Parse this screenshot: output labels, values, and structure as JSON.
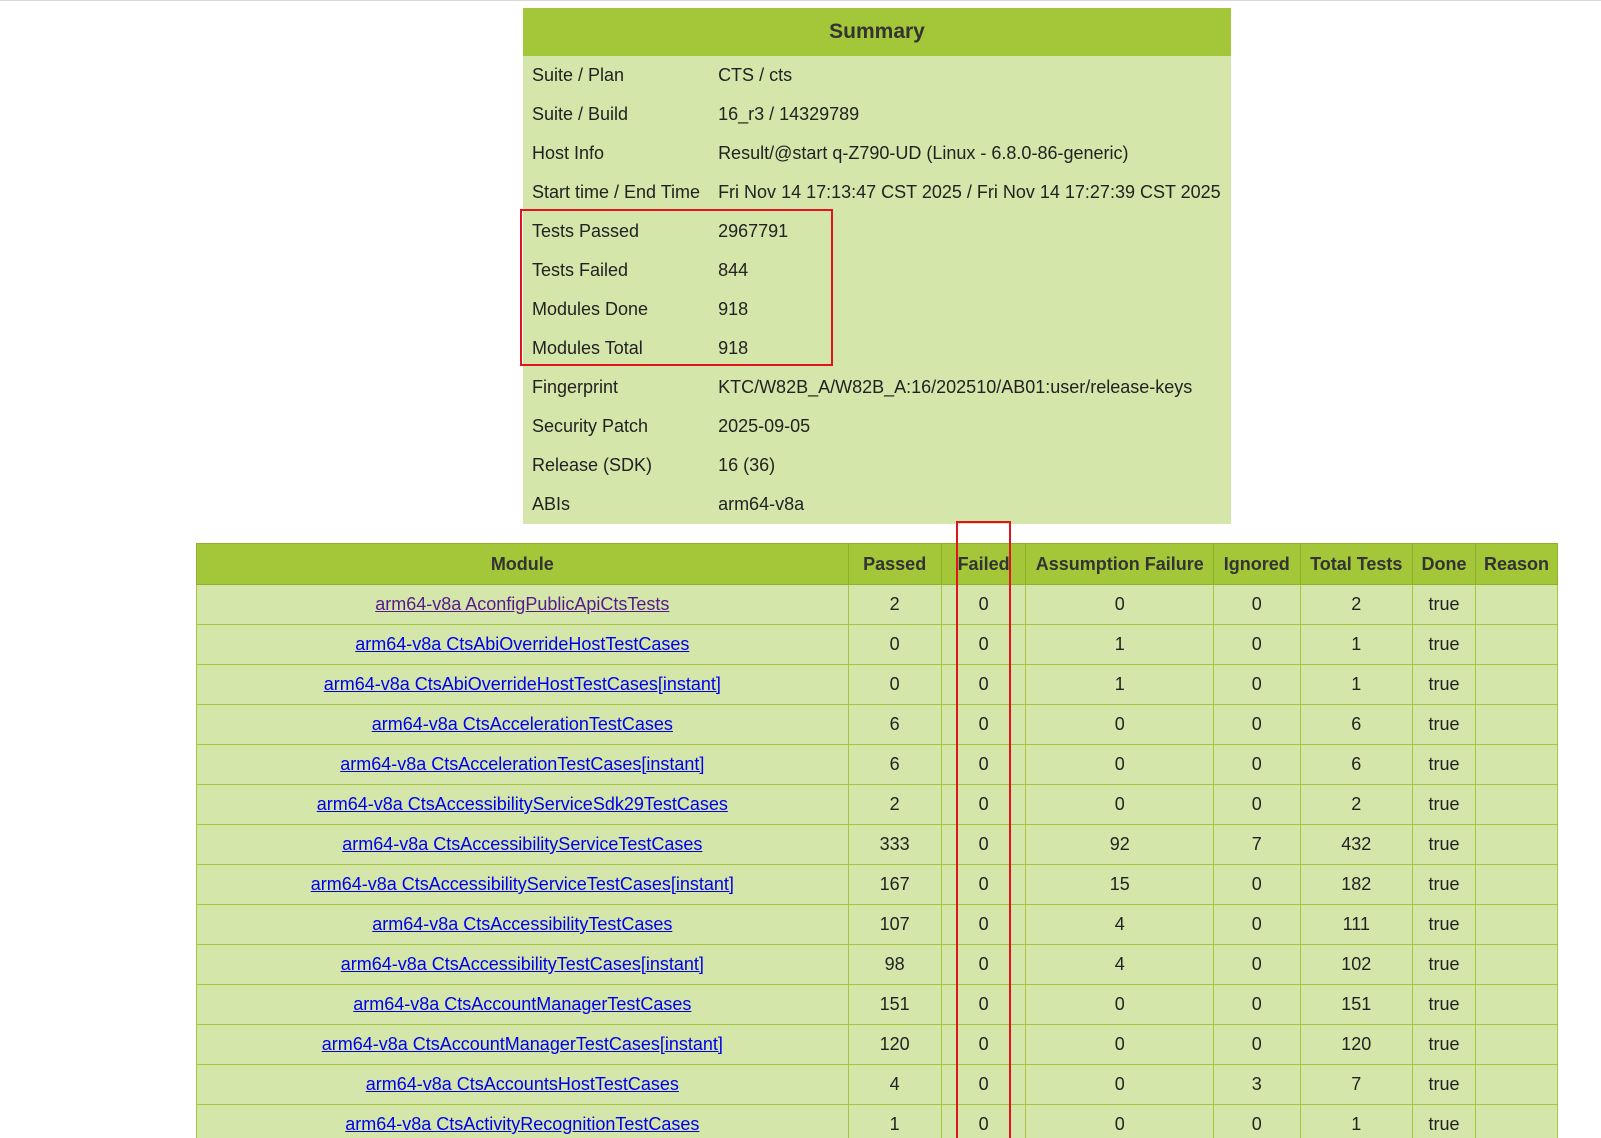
{
  "summary": {
    "title": "Summary",
    "rows": [
      {
        "label": "Suite / Plan",
        "value": "CTS / cts"
      },
      {
        "label": "Suite / Build",
        "value": "16_r3 / 14329789"
      },
      {
        "label": "Host Info",
        "value": "Result/@start q-Z790-UD (Linux - 6.8.0-86-generic)"
      },
      {
        "label": "Start time / End Time",
        "value": "Fri Nov 14 17:13:47 CST 2025 / Fri Nov 14 17:27:39 CST 2025"
      },
      {
        "label": "Tests Passed",
        "value": "2967791"
      },
      {
        "label": "Tests Failed",
        "value": "844"
      },
      {
        "label": "Modules Done",
        "value": "918"
      },
      {
        "label": "Modules Total",
        "value": "918"
      },
      {
        "label": "Fingerprint",
        "value": "KTC/W82B_A/W82B_A:16/202510/AB01:user/release-keys"
      },
      {
        "label": "Security Patch",
        "value": "2025-09-05"
      },
      {
        "label": "Release (SDK)",
        "value": "16 (36)"
      },
      {
        "label": "ABIs",
        "value": "arm64-v8a"
      }
    ]
  },
  "modules": {
    "headers": {
      "module": "Module",
      "passed": "Passed",
      "failed": "Failed",
      "assumption_failure": "Assumption Failure",
      "ignored": "Ignored",
      "total_tests": "Total Tests",
      "done": "Done",
      "reason": "Reason"
    },
    "rows": [
      {
        "module": "arm64-v8a AconfigPublicApiCtsTests",
        "visited": true,
        "passed": "2",
        "failed": "0",
        "assumption_failure": "0",
        "ignored": "0",
        "total_tests": "2",
        "done": "true",
        "reason": ""
      },
      {
        "module": "arm64-v8a CtsAbiOverrideHostTestCases",
        "visited": false,
        "passed": "0",
        "failed": "0",
        "assumption_failure": "1",
        "ignored": "0",
        "total_tests": "1",
        "done": "true",
        "reason": ""
      },
      {
        "module": "arm64-v8a CtsAbiOverrideHostTestCases[instant]",
        "visited": false,
        "passed": "0",
        "failed": "0",
        "assumption_failure": "1",
        "ignored": "0",
        "total_tests": "1",
        "done": "true",
        "reason": ""
      },
      {
        "module": "arm64-v8a CtsAccelerationTestCases",
        "visited": false,
        "passed": "6",
        "failed": "0",
        "assumption_failure": "0",
        "ignored": "0",
        "total_tests": "6",
        "done": "true",
        "reason": ""
      },
      {
        "module": "arm64-v8a CtsAccelerationTestCases[instant]",
        "visited": false,
        "passed": "6",
        "failed": "0",
        "assumption_failure": "0",
        "ignored": "0",
        "total_tests": "6",
        "done": "true",
        "reason": ""
      },
      {
        "module": "arm64-v8a CtsAccessibilityServiceSdk29TestCases",
        "visited": false,
        "passed": "2",
        "failed": "0",
        "assumption_failure": "0",
        "ignored": "0",
        "total_tests": "2",
        "done": "true",
        "reason": ""
      },
      {
        "module": "arm64-v8a CtsAccessibilityServiceTestCases",
        "visited": false,
        "passed": "333",
        "failed": "0",
        "assumption_failure": "92",
        "ignored": "7",
        "total_tests": "432",
        "done": "true",
        "reason": ""
      },
      {
        "module": "arm64-v8a CtsAccessibilityServiceTestCases[instant]",
        "visited": false,
        "passed": "167",
        "failed": "0",
        "assumption_failure": "15",
        "ignored": "0",
        "total_tests": "182",
        "done": "true",
        "reason": ""
      },
      {
        "module": "arm64-v8a CtsAccessibilityTestCases",
        "visited": false,
        "passed": "107",
        "failed": "0",
        "assumption_failure": "4",
        "ignored": "0",
        "total_tests": "111",
        "done": "true",
        "reason": ""
      },
      {
        "module": "arm64-v8a CtsAccessibilityTestCases[instant]",
        "visited": false,
        "passed": "98",
        "failed": "0",
        "assumption_failure": "4",
        "ignored": "0",
        "total_tests": "102",
        "done": "true",
        "reason": ""
      },
      {
        "module": "arm64-v8a CtsAccountManagerTestCases",
        "visited": false,
        "passed": "151",
        "failed": "0",
        "assumption_failure": "0",
        "ignored": "0",
        "total_tests": "151",
        "done": "true",
        "reason": ""
      },
      {
        "module": "arm64-v8a CtsAccountManagerTestCases[instant]",
        "visited": false,
        "passed": "120",
        "failed": "0",
        "assumption_failure": "0",
        "ignored": "0",
        "total_tests": "120",
        "done": "true",
        "reason": ""
      },
      {
        "module": "arm64-v8a CtsAccountsHostTestCases",
        "visited": false,
        "passed": "4",
        "failed": "0",
        "assumption_failure": "0",
        "ignored": "3",
        "total_tests": "7",
        "done": "true",
        "reason": ""
      },
      {
        "module": "arm64-v8a CtsActivityRecognitionTestCases",
        "visited": false,
        "passed": "1",
        "failed": "0",
        "assumption_failure": "0",
        "ignored": "0",
        "total_tests": "1",
        "done": "true",
        "reason": ""
      }
    ]
  },
  "colors": {
    "header_green": "#a4c639",
    "row_green": "#d4e6aa",
    "highlight_red": "#e0141e",
    "link_blue": "#0000ee",
    "link_visited": "#551a8b"
  }
}
